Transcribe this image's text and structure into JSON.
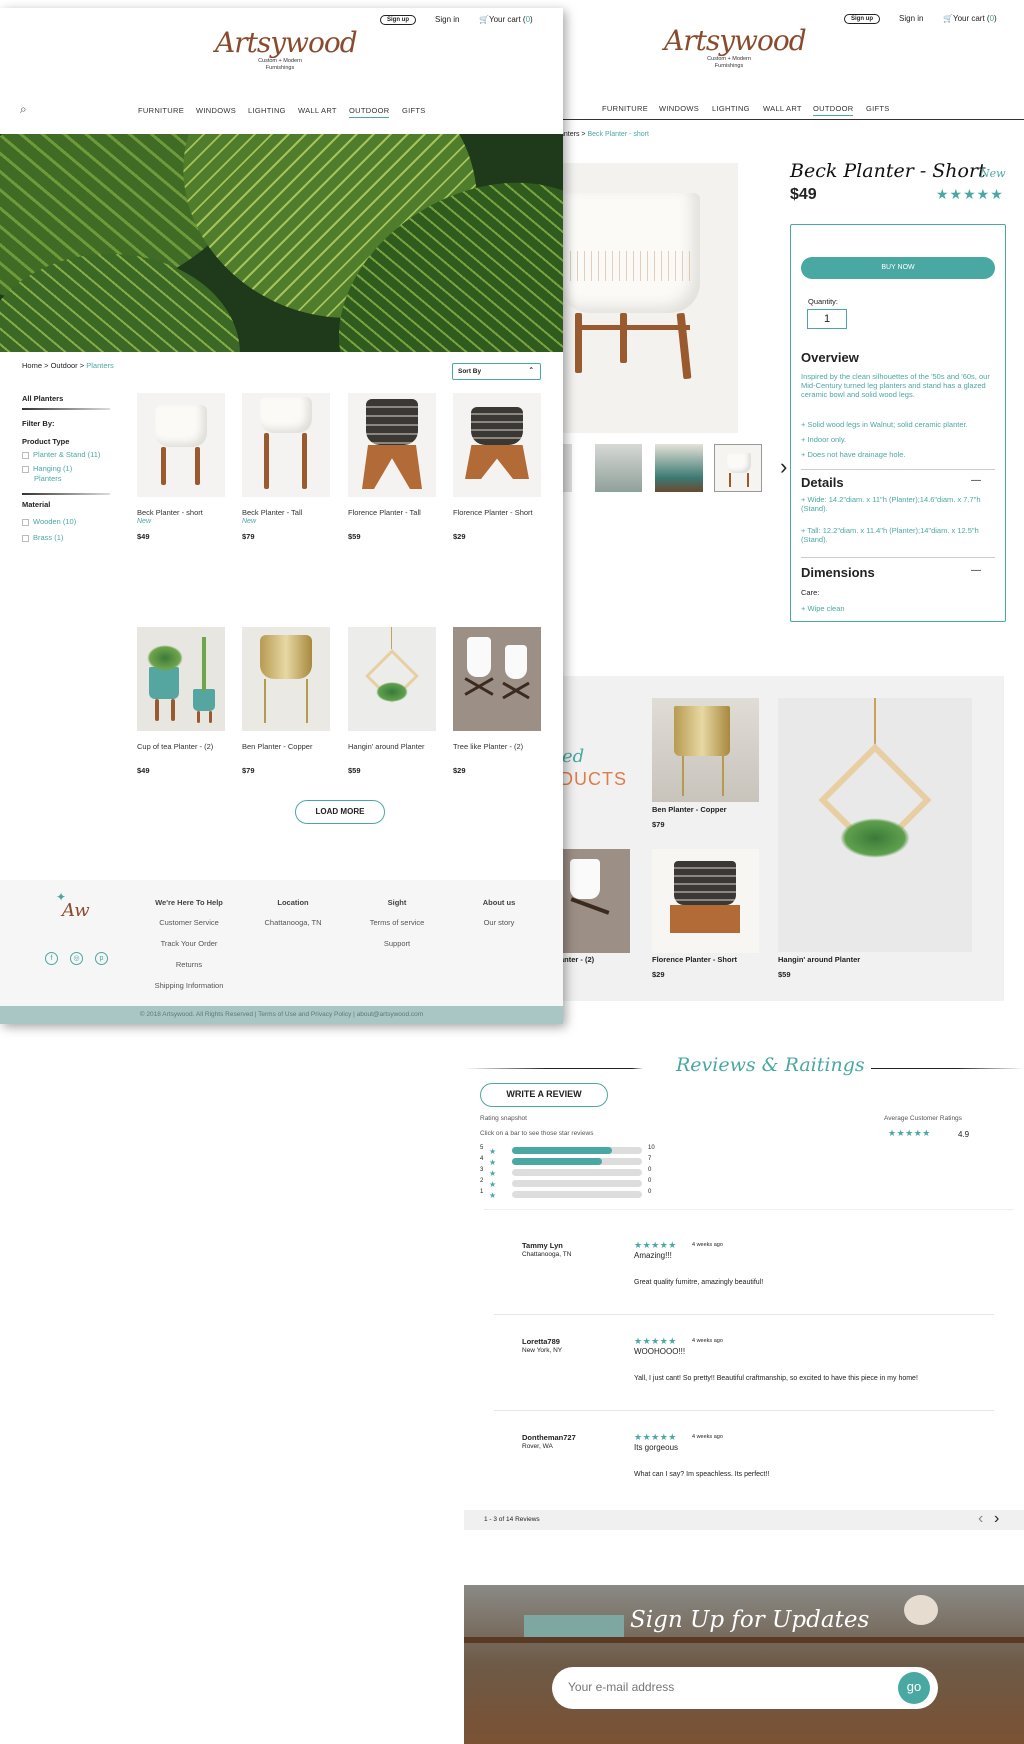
{
  "brand": {
    "name": "Artsywood",
    "tagline_1": "Custom + Modern",
    "tagline_2": "Furnishings",
    "footer_logo_text": "Aw"
  },
  "topbar": {
    "sign_up": "Sign up",
    "sign_in": "Sign in",
    "cart_label": "Your cart (",
    "cart_count": "0",
    "cart_close": ")"
  },
  "nav": {
    "items": [
      "FURNITURE",
      "WINDOWS",
      "LIGHTING",
      "WALL ART",
      "OUTDOOR",
      "GIFTS"
    ],
    "active": "OUTDOOR"
  },
  "listing": {
    "breadcrumb": {
      "home": "Home >",
      "outdoor": "Outdoor",
      "sep": ">",
      "current": "Planters"
    },
    "sort_label": "Sort By",
    "sidebar": {
      "all": "All Planters",
      "filter_by": "Filter By:",
      "product_type": "Product Type",
      "types": [
        "Planter & Stand (11)",
        "Hanging (1)",
        "Planters"
      ],
      "material": "Material",
      "materials": [
        "Wooden (10)",
        "Brass (1)"
      ]
    },
    "products": [
      {
        "name": "Beck Planter - short",
        "badge": "New",
        "price": "$49"
      },
      {
        "name": "Beck Planter - Tall",
        "badge": "New",
        "price": "$79"
      },
      {
        "name": "Florence Planter - Tall",
        "badge": "",
        "price": "$59"
      },
      {
        "name": "Florence Planter - Short",
        "badge": "",
        "price": "$29"
      },
      {
        "name": "Cup of tea Planter - (2)",
        "badge": "",
        "price": "$49"
      },
      {
        "name": "Ben Planter - Copper",
        "badge": "",
        "price": "$79"
      },
      {
        "name": "Hangin' around Planter",
        "badge": "",
        "price": "$59"
      },
      {
        "name": "Tree like Planter - (2)",
        "badge": "",
        "price": "$29"
      }
    ],
    "load_more": "LOAD MORE"
  },
  "footer": {
    "cols": [
      {
        "heading": "We're Here To Help",
        "links": [
          "Customer Service",
          "Track Your Order",
          "Returns",
          "Shipping Information"
        ]
      },
      {
        "heading": "Location",
        "links": [
          "Chattanooga, TN"
        ]
      },
      {
        "heading": "Sight",
        "links": [
          "Terms of service",
          "Support"
        ]
      },
      {
        "heading": "About us",
        "links": [
          "Our story"
        ]
      }
    ],
    "social": [
      "f",
      "◎",
      "p"
    ],
    "copyright": "© 2018 Artsywood. All Rights Reserved | Terms of Use and Privacy Policy |   about@artsywood.com"
  },
  "product": {
    "breadcrumb_partial": "anters",
    "breadcrumb_sep": ">",
    "breadcrumb_current": "Beck Planter - short",
    "title": "Beck Planter - Short",
    "badge": "New",
    "price": "$49",
    "stars": "★★★★★",
    "buy_now": "BUY NOW",
    "quantity_label": "Quantity:",
    "quantity_value": "1",
    "overview_title": "Overview",
    "overview_text": "Inspired by the clean silhouettes of the '50s and '60s, our Mid-Century turned leg planters and stand has a glazed ceramic bowl and solid wood legs.",
    "overview_bullets": [
      "Solid wood legs in Walnut; solid ceramic planter.",
      "Indoor only.",
      "Does not have drainage hole."
    ],
    "details_title": "Details",
    "details_bullets": [
      "Wide: 14.2\"diam. x 11\"h (Planter);14.6\"diam. x 7.7\"h (Stand).",
      "Tall: 12.2\"diam. x 11.4\"h (Planter);14\"diam. x 12.5\"h (Stand)."
    ],
    "dimensions_title": "Dimensions",
    "care_label": "Care:",
    "care_bullets": [
      "Wipe clean"
    ],
    "collapse_icon": "—",
    "next_icon": "›"
  },
  "related": {
    "title_top": "ed",
    "title_bottom": "DUCTS",
    "items": [
      {
        "name": "Ben Planter - Copper",
        "price": "$79"
      },
      {
        "name": "anter - (2)",
        "price": ""
      },
      {
        "name": "Florence Planter - Short",
        "price": "$29"
      },
      {
        "name": "Hangin' around Planter",
        "price": "$59"
      }
    ]
  },
  "reviews": {
    "title": "Reviews & Raitings",
    "write_button": "WRITE A REVIEW",
    "snapshot_label": "Rating snapshot",
    "snapshot_hint": "Click on a bar to see those star reviews",
    "average_label": "Average Customer Ratings",
    "average_value": "4.9",
    "bars": [
      {
        "star": "5",
        "count": "10",
        "fraction": 0.77
      },
      {
        "star": "4",
        "count": "7",
        "fraction": 0.69
      },
      {
        "star": "3",
        "count": "0",
        "fraction": 0
      },
      {
        "star": "2",
        "count": "0",
        "fraction": 0
      },
      {
        "star": "1",
        "count": "0",
        "fraction": 0
      }
    ],
    "items": [
      {
        "name": "Tammy Lyn",
        "location": "Chattanooga, TN",
        "time": "4 weeks ago",
        "title": "Amazing!!!",
        "body": "Great quality furnitre, amazingly beautiful!"
      },
      {
        "name": "Loretta789",
        "location": "New York, NY",
        "time": "4 weeks ago",
        "title": "WOOHOOO!!!",
        "body": "Yall, I just cant! So pretty!! Beautiful craftmanship, so excited to have this piece in my home!"
      },
      {
        "name": "Dontheman727",
        "location": "Rover, WA",
        "time": "4 weeks ago",
        "title": "Its gorgeous",
        "body": "What can I say? Im speachless. Its perfect!!"
      }
    ],
    "pagination": "1 - 3 of 14 Reviews",
    "prev_icon": "‹",
    "next_icon": "›"
  },
  "signup": {
    "title": "Sign Up for Updates",
    "placeholder": "Your e-mail address",
    "go": "go"
  },
  "colors": {
    "accent": "#4aa8a3",
    "brand_brown": "#8a4b2d",
    "related_orange": "#e07b4a",
    "footer_band": "#a9c6c4"
  }
}
